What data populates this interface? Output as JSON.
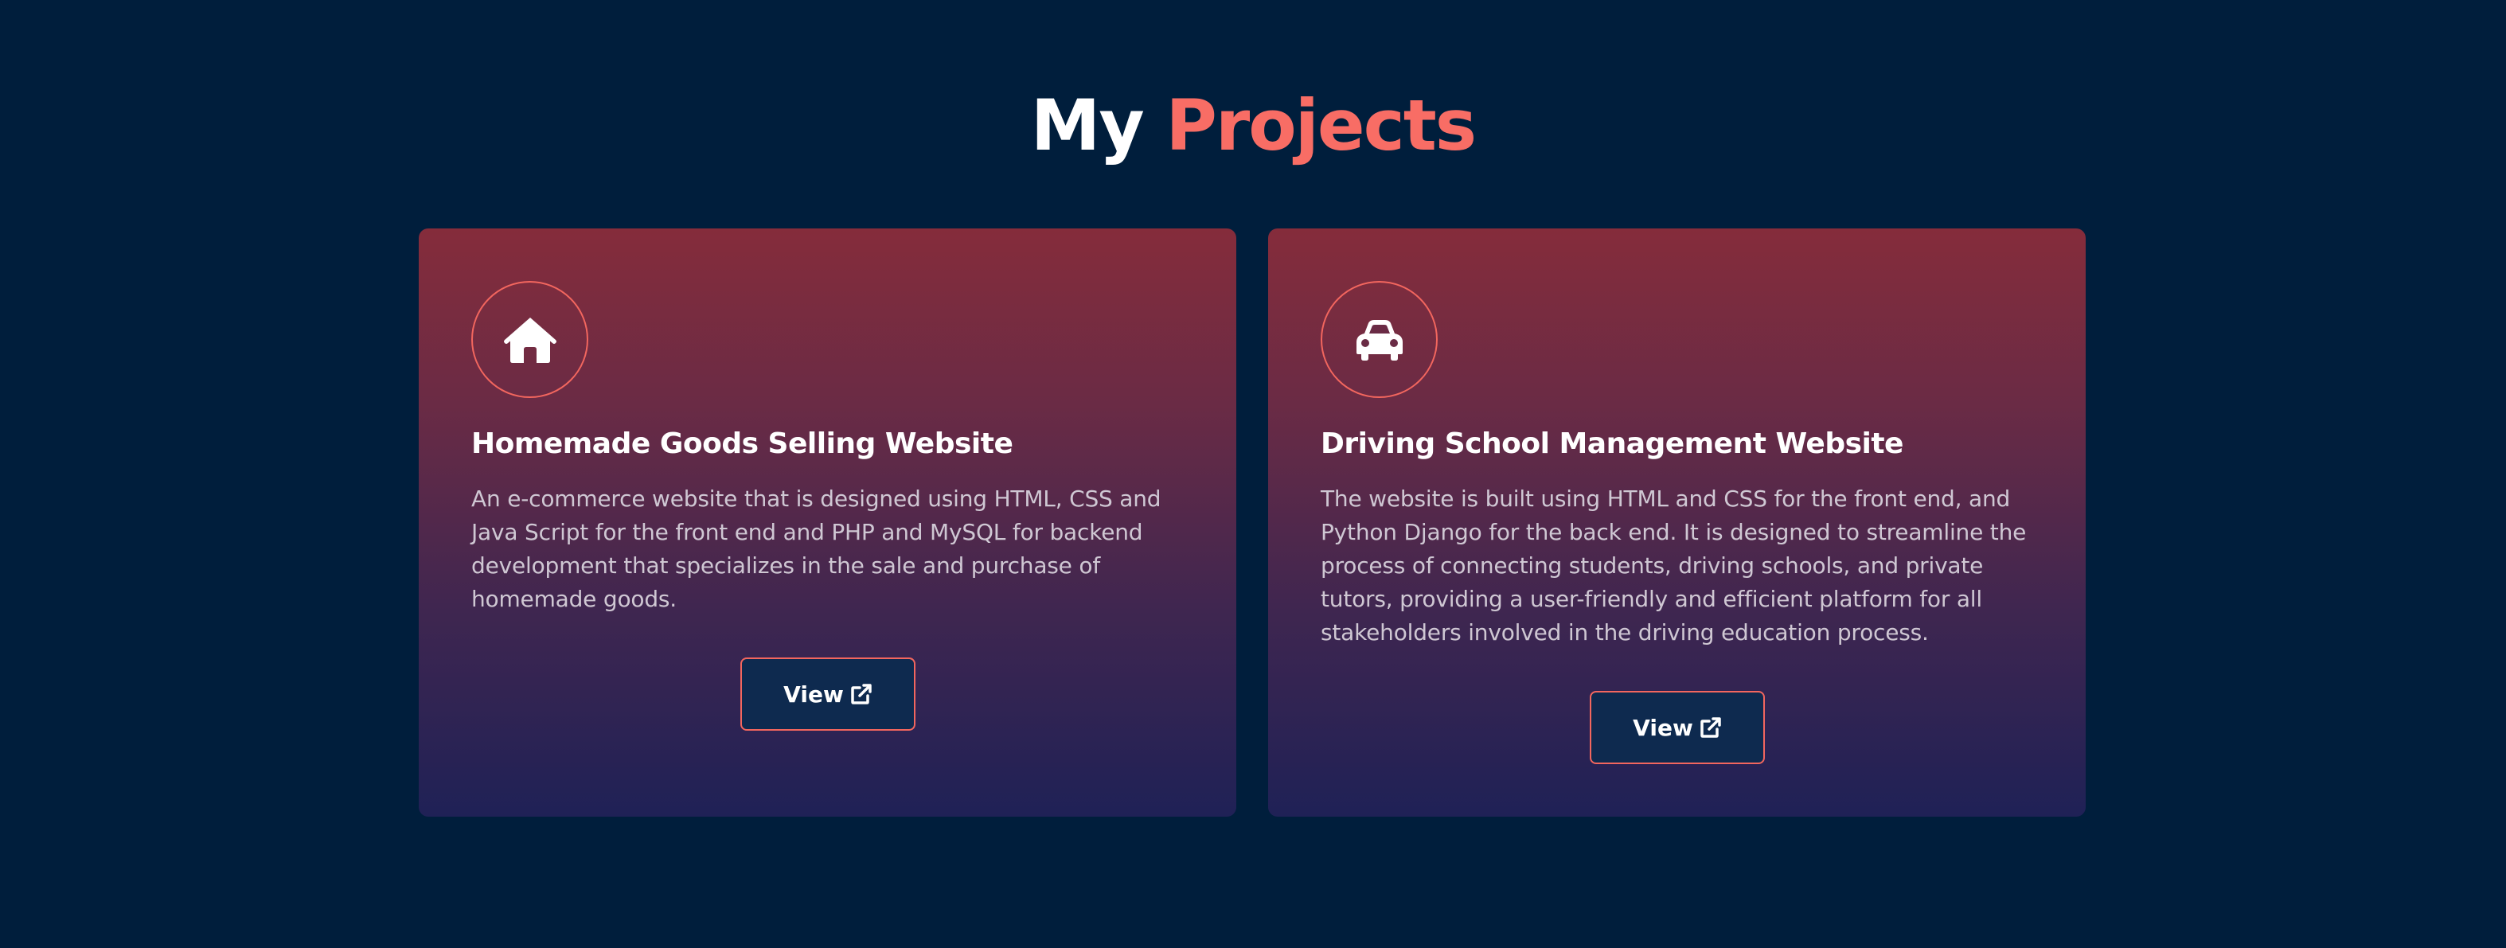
{
  "section": {
    "title_part1": "My",
    "title_part2": "Projects",
    "title_accent_color": "#f86d65",
    "background_color": "#001e3c"
  },
  "projects": [
    {
      "icon": "house-icon",
      "title": "Homemade Goods Selling Website",
      "description": "An e-commerce website that is designed using HTML, CSS and Java Script for the front end and PHP and MySQL for backend development that specializes in the sale and purchase of homemade goods.",
      "button_label": "View",
      "button_icon": "external-link-icon"
    },
    {
      "icon": "car-icon",
      "title": "Driving School Management Website",
      "description": "The website is built using HTML and CSS for the front end, and Python Django for the back end. It is designed to streamline the process of connecting students, driving schools, and private tutors, providing a user-friendly and efficient platform for all stakeholders involved in the driving education process.",
      "button_label": "View",
      "button_icon": "external-link-icon"
    }
  ]
}
